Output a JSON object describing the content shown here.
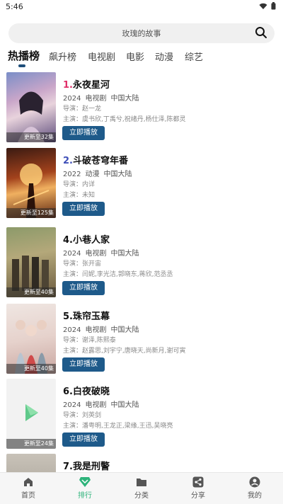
{
  "status": {
    "time": "5:46"
  },
  "search": {
    "placeholder": "玫瑰的故事"
  },
  "tabs": [
    {
      "label": "热播榜"
    },
    {
      "label": "飙升榜"
    },
    {
      "label": "电视剧"
    },
    {
      "label": "电影"
    },
    {
      "label": "动漫"
    },
    {
      "label": "综艺"
    }
  ],
  "items": [
    {
      "rank": "1.",
      "title": "永夜星河",
      "year": "2024",
      "genre": "电视剧",
      "region": "中国大陆",
      "director": "导演：赵一龙",
      "cast": "主演：虞书欣,丁禹兮,祝绪丹,杨仕泽,陈都灵",
      "badge": "更新至32集",
      "play": "立即播放",
      "rank_color": "#e0306a"
    },
    {
      "rank": "2.",
      "title": "斗破苍穹年番",
      "year": "2022",
      "genre": "动漫",
      "region": "中国大陆",
      "director": "导演：内详",
      "cast": "主演：未知",
      "badge": "更新至125集",
      "play": "立即播放",
      "rank_color": "#3f4fb8"
    },
    {
      "rank": "4.",
      "title": "小巷人家",
      "year": "2024",
      "genre": "电视剧",
      "region": "中国大陆",
      "director": "导演：张开宙",
      "cast": "主演：闫妮,李光洁,郭晓东,蒋欣,范丞丞",
      "badge": "更新至40集",
      "play": "立即播放",
      "rank_color": "#111111"
    },
    {
      "rank": "5.",
      "title": "珠帘玉幕",
      "year": "2024",
      "genre": "电视剧",
      "region": "中国大陆",
      "director": "导演：谢泽,陈熙泰",
      "cast": "主演：赵露思,刘宇宁,唐晓天,尚新月,谢可寅",
      "badge": "更新至40集",
      "play": "立即播放",
      "rank_color": "#111111"
    },
    {
      "rank": "6.",
      "title": "白夜破晓",
      "year": "2024",
      "genre": "电视剧",
      "region": "中国大陆",
      "director": "导演：刘英剑",
      "cast": "主演：潘粤明,王龙正,梁缘,王迅,吴晓亮",
      "badge": "更新至24集",
      "play": "立即播放",
      "rank_color": "#111111"
    },
    {
      "rank": "7.",
      "title": "我是刑警",
      "year": "",
      "genre": "",
      "region": "",
      "director": "",
      "cast": "",
      "badge": "",
      "play": "",
      "rank_color": "#111111"
    }
  ],
  "nav": [
    {
      "label": "首页",
      "icon": "home-icon"
    },
    {
      "label": "排行",
      "icon": "ranking-icon"
    },
    {
      "label": "分类",
      "icon": "folder-icon"
    },
    {
      "label": "分享",
      "icon": "share-icon"
    },
    {
      "label": "我的",
      "icon": "profile-icon"
    }
  ],
  "colors": {
    "accent": "#1e5a8a",
    "nav_active": "#2db37a"
  }
}
